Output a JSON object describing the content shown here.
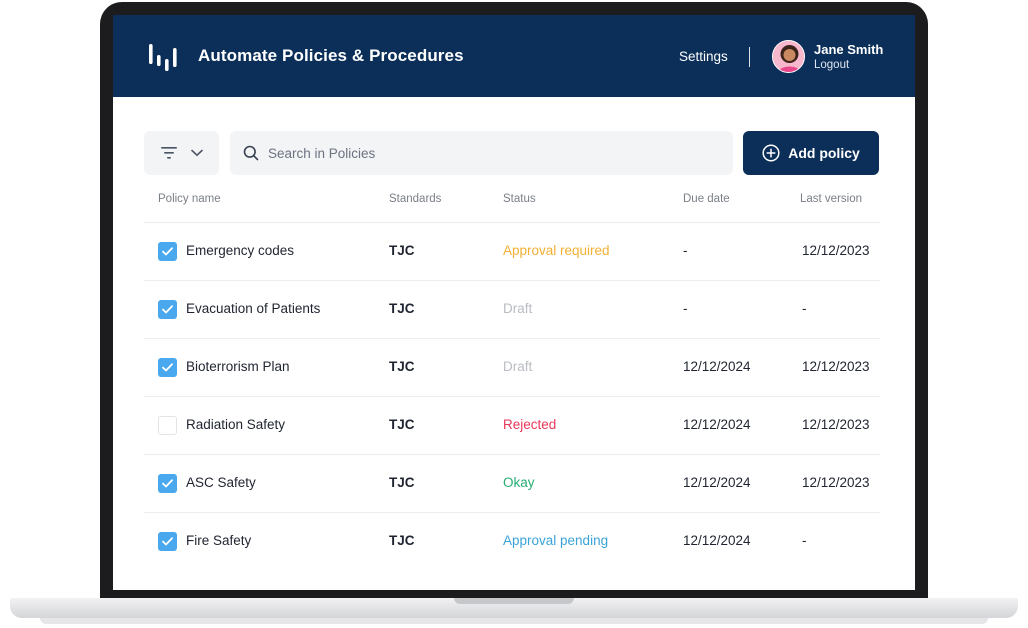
{
  "header": {
    "title": "Automate Policies & Procedures",
    "settings_label": "Settings",
    "user_name": "Jane Smith",
    "logout_label": "Logout"
  },
  "toolbar": {
    "search_placeholder": "Search in Policies",
    "add_label": "Add policy"
  },
  "table": {
    "columns": [
      "Policy name",
      "Standards",
      "Status",
      "Due date",
      "Last version"
    ],
    "rows": [
      {
        "checked": true,
        "name": "Emergency codes",
        "standard": "TJC",
        "status": "Approval required",
        "status_color": "#f2b035",
        "due": "-",
        "last": "12/12/2023"
      },
      {
        "checked": true,
        "name": "Evacuation of Patients",
        "standard": "TJC",
        "status": "Draft",
        "status_color": "#b9bcc2",
        "due": "-",
        "last": "-"
      },
      {
        "checked": true,
        "name": "Bioterrorism Plan",
        "standard": "TJC",
        "status": "Draft",
        "status_color": "#b9bcc2",
        "due": "12/12/2024",
        "last": "12/12/2023"
      },
      {
        "checked": false,
        "name": "Radiation Safety",
        "standard": "TJC",
        "status": "Rejected",
        "status_color": "#e8385a",
        "due": "12/12/2024",
        "last": "12/12/2023"
      },
      {
        "checked": true,
        "name": "ASC Safety",
        "standard": "TJC",
        "status": "Okay",
        "status_color": "#27ae74",
        "due": "12/12/2024",
        "last": "12/12/2023"
      },
      {
        "checked": true,
        "name": "Fire Safety",
        "standard": "TJC",
        "status": "Approval pending",
        "status_color": "#3aa3d8",
        "due": "12/12/2024",
        "last": "-"
      }
    ]
  },
  "colors": {
    "brand": "#0b2f59",
    "checkbox": "#4aa8ee"
  },
  "icons": [
    "app-logo-icon",
    "avatar",
    "filter-icon",
    "chevron-down-icon",
    "search-icon",
    "plus-circle-icon",
    "check-icon"
  ]
}
